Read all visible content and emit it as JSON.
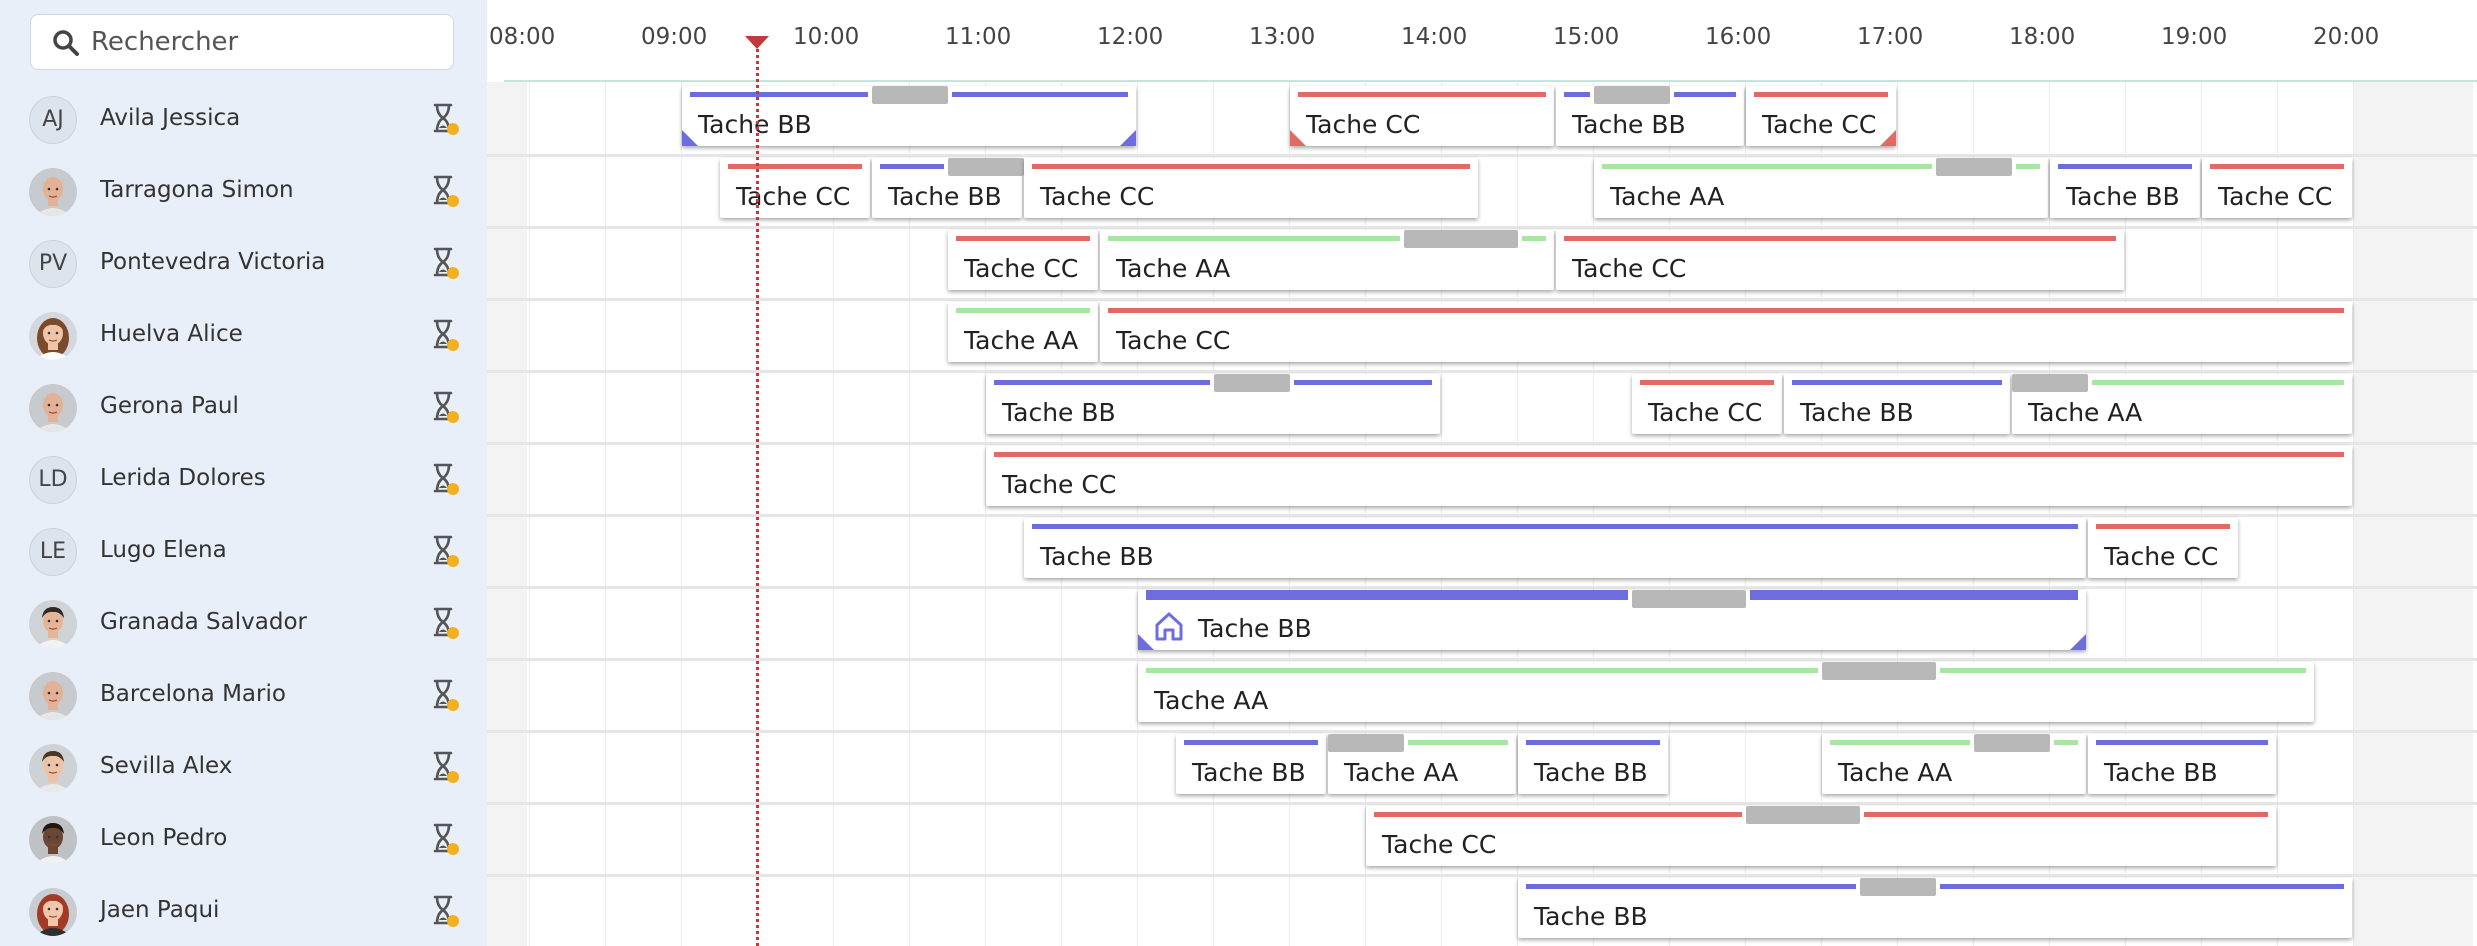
{
  "search": {
    "placeholder": "Rechercher",
    "value": ""
  },
  "colors": {
    "AA": "#a8e6a1",
    "BB": "#6e6ddd",
    "CC": "#e16a64",
    "gap": "#b8b8b8",
    "now": "#c0393b",
    "badge": "#f2b01e"
  },
  "timeline": {
    "hours": [
      "08:00",
      "09:00",
      "10:00",
      "11:00",
      "12:00",
      "13:00",
      "14:00",
      "15:00",
      "16:00",
      "17:00",
      "18:00",
      "19:00",
      "20:00"
    ],
    "now": "09:30"
  },
  "resources": [
    {
      "name": "Avila Jessica",
      "initials": "AJ",
      "avatar": "initials",
      "icon": "hourglass-icon"
    },
    {
      "name": "Tarragona Simon",
      "avatar": "photo-bald-male",
      "icon": "hourglass-icon"
    },
    {
      "name": "Pontevedra Victoria",
      "initials": "PV",
      "avatar": "initials",
      "icon": "hourglass-icon"
    },
    {
      "name": "Huelva Alice",
      "avatar": "photo-female-brown",
      "icon": "hourglass-icon"
    },
    {
      "name": "Gerona Paul",
      "avatar": "photo-bald-male",
      "icon": "hourglass-icon"
    },
    {
      "name": "Lerida Dolores",
      "initials": "LD",
      "avatar": "initials",
      "icon": "hourglass-icon"
    },
    {
      "name": "Lugo Elena",
      "initials": "LE",
      "avatar": "initials",
      "icon": "hourglass-icon"
    },
    {
      "name": "Granada Salvador",
      "avatar": "photo-dark-hair-male",
      "icon": "hourglass-icon"
    },
    {
      "name": "Barcelona Mario",
      "avatar": "photo-bald-male",
      "icon": "hourglass-icon"
    },
    {
      "name": "Sevilla Alex",
      "avatar": "photo-young-male",
      "icon": "hourglass-icon"
    },
    {
      "name": "Leon Pedro",
      "avatar": "photo-dark-skin-male",
      "icon": "hourglass-icon"
    },
    {
      "name": "Jaen Paqui",
      "avatar": "photo-female-red",
      "icon": "hourglass-icon"
    }
  ],
  "tasks": [
    {
      "row": 0,
      "start": "09:00",
      "end": "12:00",
      "type": "BB",
      "label": "Tache BB",
      "gaps": [
        [
          "10:15",
          "10:45"
        ]
      ],
      "corners": true
    },
    {
      "row": 0,
      "start": "13:00",
      "end": "14:45",
      "type": "CC",
      "label": "Tache CC",
      "cornerLeft": true
    },
    {
      "row": 0,
      "start": "14:45",
      "end": "16:00",
      "type": "BB",
      "label": "Tache BB",
      "gaps": [
        [
          "15:00",
          "15:30"
        ]
      ]
    },
    {
      "row": 0,
      "start": "16:00",
      "end": "17:00",
      "type": "CC",
      "label": "Tache CC",
      "cornerRight": true
    },
    {
      "row": 1,
      "start": "09:15",
      "end": "10:15",
      "type": "CC",
      "label": "Tache CC"
    },
    {
      "row": 1,
      "start": "10:15",
      "end": "11:15",
      "type": "BB",
      "label": "Tache BB",
      "gaps": [
        [
          "10:45",
          "11:15"
        ]
      ]
    },
    {
      "row": 1,
      "start": "11:15",
      "end": "14:15",
      "type": "CC",
      "label": "Tache CC"
    },
    {
      "row": 1,
      "start": "15:00",
      "end": "18:00",
      "type": "AA",
      "label": "Tache AA",
      "gaps": [
        [
          "17:15",
          "17:45"
        ]
      ]
    },
    {
      "row": 1,
      "start": "18:00",
      "end": "19:00",
      "type": "BB",
      "label": "Tache BB"
    },
    {
      "row": 1,
      "start": "19:00",
      "end": "20:00",
      "type": "CC",
      "label": "Tache CC"
    },
    {
      "row": 2,
      "start": "10:45",
      "end": "11:45",
      "type": "CC",
      "label": "Tache CC"
    },
    {
      "row": 2,
      "start": "11:45",
      "end": "14:45",
      "type": "AA",
      "label": "Tache AA",
      "gaps": [
        [
          "13:45",
          "14:30"
        ]
      ]
    },
    {
      "row": 2,
      "start": "14:45",
      "end": "18:30",
      "type": "CC",
      "label": "Tache CC"
    },
    {
      "row": 3,
      "start": "10:45",
      "end": "11:45",
      "type": "AA",
      "label": "Tache AA"
    },
    {
      "row": 3,
      "start": "11:45",
      "end": "20:00",
      "type": "CC",
      "label": "Tache CC"
    },
    {
      "row": 4,
      "start": "11:00",
      "end": "14:00",
      "type": "BB",
      "label": "Tache BB",
      "gaps": [
        [
          "12:30",
          "13:00"
        ]
      ]
    },
    {
      "row": 4,
      "start": "15:15",
      "end": "16:15",
      "type": "CC",
      "label": "Tache CC"
    },
    {
      "row": 4,
      "start": "16:15",
      "end": "17:45",
      "type": "BB",
      "label": "Tache BB"
    },
    {
      "row": 4,
      "start": "17:45",
      "end": "20:00",
      "type": "AA",
      "label": "Tache AA",
      "gaps": [
        [
          "17:45",
          "18:15"
        ]
      ]
    },
    {
      "row": 5,
      "start": "11:00",
      "end": "20:00",
      "type": "CC",
      "label": "Tache CC"
    },
    {
      "row": 6,
      "start": "11:15",
      "end": "18:15",
      "type": "BB",
      "label": "Tache BB"
    },
    {
      "row": 6,
      "start": "18:15",
      "end": "19:15",
      "type": "CC",
      "label": "Tache CC"
    },
    {
      "row": 7,
      "start": "12:00",
      "end": "18:15",
      "type": "BB",
      "label": "Tache BB",
      "gaps": [
        [
          "15:15",
          "16:00"
        ]
      ],
      "icon": "house-icon",
      "corners": true,
      "thick": true
    },
    {
      "row": 8,
      "start": "12:00",
      "end": "19:45",
      "type": "AA",
      "label": "Tache AA",
      "gaps": [
        [
          "16:30",
          "17:15"
        ]
      ]
    },
    {
      "row": 9,
      "start": "12:15",
      "end": "13:15",
      "type": "BB",
      "label": "Tache BB"
    },
    {
      "row": 9,
      "start": "13:15",
      "end": "14:30",
      "type": "AA",
      "label": "Tache AA",
      "gaps": [
        [
          "13:15",
          "13:45"
        ]
      ]
    },
    {
      "row": 9,
      "start": "14:30",
      "end": "15:30",
      "type": "BB",
      "label": "Tache BB"
    },
    {
      "row": 9,
      "start": "16:30",
      "end": "18:15",
      "type": "AA",
      "label": "Tache AA",
      "gaps": [
        [
          "17:30",
          "18:00"
        ]
      ]
    },
    {
      "row": 9,
      "start": "18:15",
      "end": "19:30",
      "type": "BB",
      "label": "Tache BB"
    },
    {
      "row": 10,
      "start": "13:30",
      "end": "19:30",
      "type": "CC",
      "label": "Tache CC",
      "gaps": [
        [
          "16:00",
          "16:45"
        ]
      ]
    },
    {
      "row": 11,
      "start": "14:30",
      "end": "20:00",
      "type": "BB",
      "label": "Tache BB",
      "gaps": [
        [
          "16:45",
          "17:15"
        ]
      ]
    }
  ]
}
